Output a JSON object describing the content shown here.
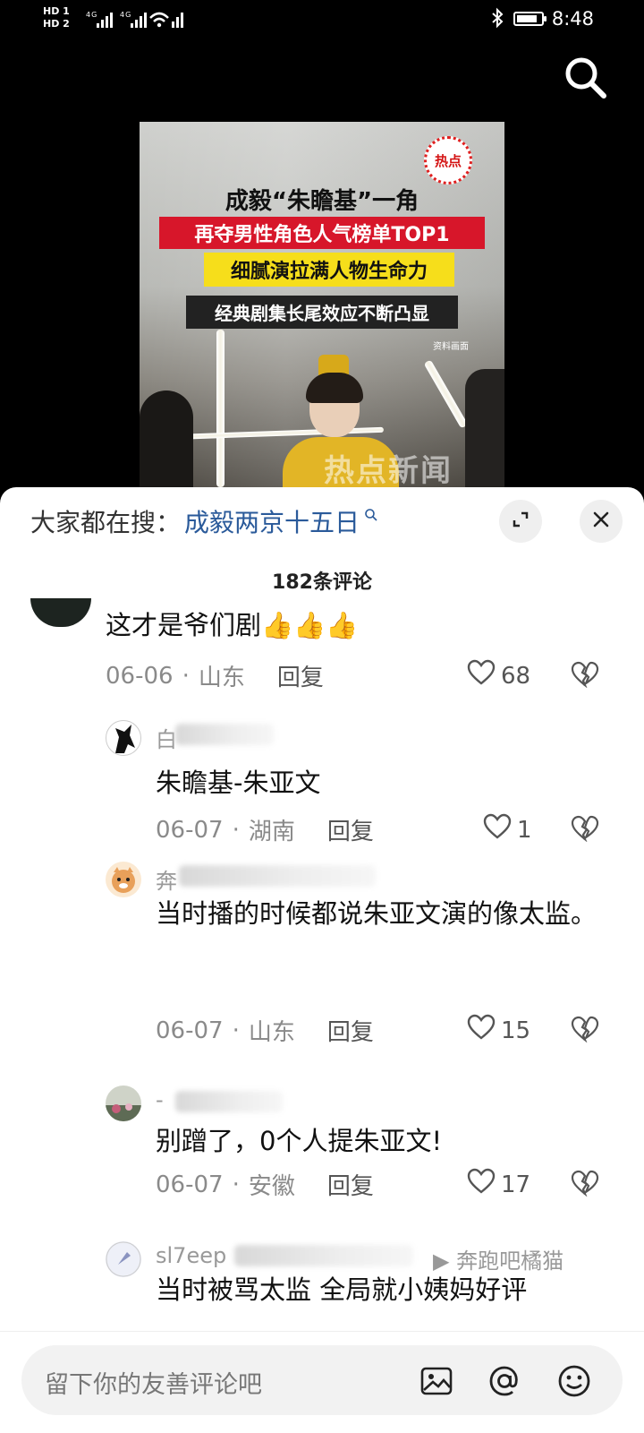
{
  "status_bar": {
    "sim1": "HD 1",
    "sim2": "HD 2",
    "network": "4G",
    "time": "8:48",
    "battery_level": 0.85
  },
  "video": {
    "badge": "热点",
    "title": "成毅“朱瞻基”一角",
    "line1": "再夺男性角色人气榜单TOP1",
    "line2": "细腻演拉满人物生命力",
    "line3": "经典剧集长尾效应不断凸显",
    "note": "资料画面",
    "watermark": "热点新闻"
  },
  "sheet": {
    "trend_label": "大家都在搜：",
    "trend_term": "成毅两京十五日",
    "comment_count": "182条评论"
  },
  "comments": [
    {
      "text": "这才是爷们剧👍👍👍",
      "date": "06-06",
      "location": "山东",
      "reply": "回复",
      "likes": "68"
    },
    {
      "name": "白",
      "text": "朱瞻基-朱亚文",
      "date": "06-07",
      "location": "湖南",
      "reply": "回复",
      "likes": "1"
    },
    {
      "name": "奔",
      "text": "当时播的时候都说朱亚文演的像太监。",
      "date": "06-07",
      "location": "山东",
      "reply": "回复",
      "likes": "15"
    },
    {
      "name": "-",
      "text": "别蹭了，0个人提朱亚文!",
      "date": "06-07",
      "location": "安徽",
      "reply": "回复",
      "likes": "17"
    },
    {
      "name": "sl7eep",
      "name_tail": "▶ 奔跑吧橘猫",
      "text": "当时被骂太监 全局就小姨妈好评"
    }
  ],
  "input": {
    "placeholder": "留下你的友善评论吧"
  },
  "icons": [
    "search-icon",
    "expand-icon",
    "close-icon",
    "heart-icon",
    "broken-heart-icon",
    "image-icon",
    "at-icon",
    "emoji-icon"
  ]
}
